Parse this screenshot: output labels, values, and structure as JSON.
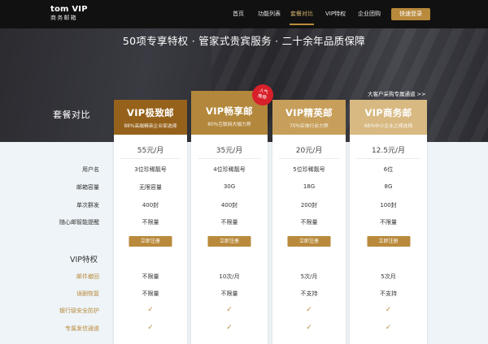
{
  "nav": {
    "logo_line1": "tom VIP",
    "logo_line2": "商务邮箱",
    "items": [
      "首页",
      "功能列表",
      "套餐对比",
      "VIP特权",
      "企业团购"
    ],
    "active_index": 2,
    "login_label": "快速登录"
  },
  "hero": {
    "title": "50项专享特权 · 管家式贵宾服务 · 二十余年品质保障",
    "enterprise_link": "大客户采购专属通道 >>",
    "compare_title": "套餐对比"
  },
  "row_labels": {
    "username": "用户名",
    "capacity": "邮箱容量",
    "bulk_send": "单次群发",
    "reminder": "随心邮智能提醒",
    "vip_section": "VIP特权",
    "recall": "邮件撤回",
    "recovery": "误删恢复",
    "bank_security": "银行级安全防护",
    "send_channel": "专属发信通道"
  },
  "plans": [
    {
      "name": "VIP极致邮",
      "subtitle": "88%高端精英企业家选择",
      "price": "55元/月",
      "username": "3位珍稀靓号",
      "capacity": "无限容量",
      "bulk_send": "400封",
      "reminder": "不限量",
      "register_label": "立即注册",
      "recall": "不限量",
      "recovery": "不限量",
      "bank_security": "✓",
      "send_channel": "✓",
      "header_color": "#96621b"
    },
    {
      "name": "VIP畅享邮",
      "subtitle": "80%互联网大咖力荐",
      "price": "35元/月",
      "username": "4位珍稀靓号",
      "capacity": "30G",
      "bulk_send": "400封",
      "reminder": "不限量",
      "register_label": "立即注册",
      "recall": "10次/月",
      "recovery": "不限量",
      "bank_security": "✓",
      "send_channel": "✓",
      "header_color": "#b3883c",
      "badge": "人气\n推荐"
    },
    {
      "name": "VIP精英邮",
      "subtitle": "70%实体行业力荐",
      "price": "20元/月",
      "username": "5位珍稀靓号",
      "capacity": "18G",
      "bulk_send": "200封",
      "reminder": "不限量",
      "register_label": "立即注册",
      "recall": "5次/月",
      "recovery": "不支持",
      "bank_security": "✓",
      "send_channel": "✓",
      "header_color": "#c79f5b"
    },
    {
      "name": "VIP商务邮",
      "subtitle": "68%中小企业之择选择",
      "price": "12.5元/月",
      "username": "6位",
      "capacity": "8G",
      "bulk_send": "100封",
      "reminder": "不限量",
      "register_label": "立即注册",
      "recall": "5次月",
      "recovery": "不支持",
      "bank_security": "✓",
      "send_channel": "✓",
      "header_color": "#d8b982"
    }
  ]
}
